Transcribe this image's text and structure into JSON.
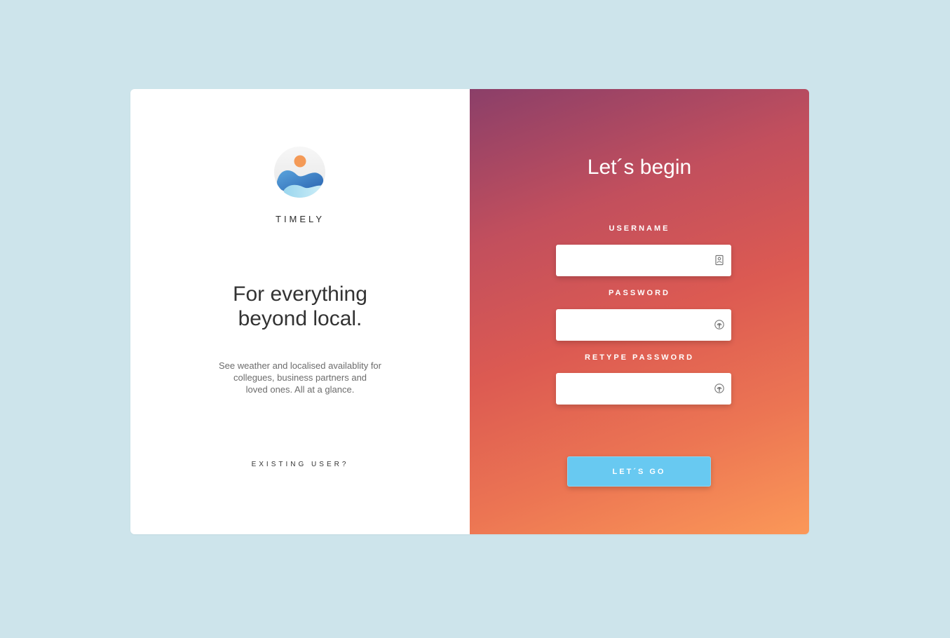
{
  "brand": {
    "name": "TIMELY",
    "logo_icon": "mountain-sun-logo-icon"
  },
  "intro": {
    "tagline_lines": [
      "For everything",
      "beyond local."
    ],
    "description_lines": [
      "See weather and localised availablity for",
      "collegues, business partners and",
      "loved ones. All at a glance."
    ],
    "existing_user_link": "EXISTING USER?"
  },
  "form": {
    "heading": "Let´s begin",
    "username": {
      "label": "USERNAME",
      "value": "",
      "icon": "contact-card-icon"
    },
    "password": {
      "label": "PASSWORD",
      "value": "",
      "icon": "fingerprint-icon"
    },
    "retype_password": {
      "label": "RETYPE PASSWORD",
      "value": "",
      "icon": "fingerprint-icon"
    },
    "submit_label": "LET´S GO"
  },
  "colors": {
    "background": "#cde4eb",
    "gradient_start": "#8b3f69",
    "gradient_mid": "#dc5a52",
    "gradient_end": "#fb9858",
    "button": "#68c9f1"
  }
}
